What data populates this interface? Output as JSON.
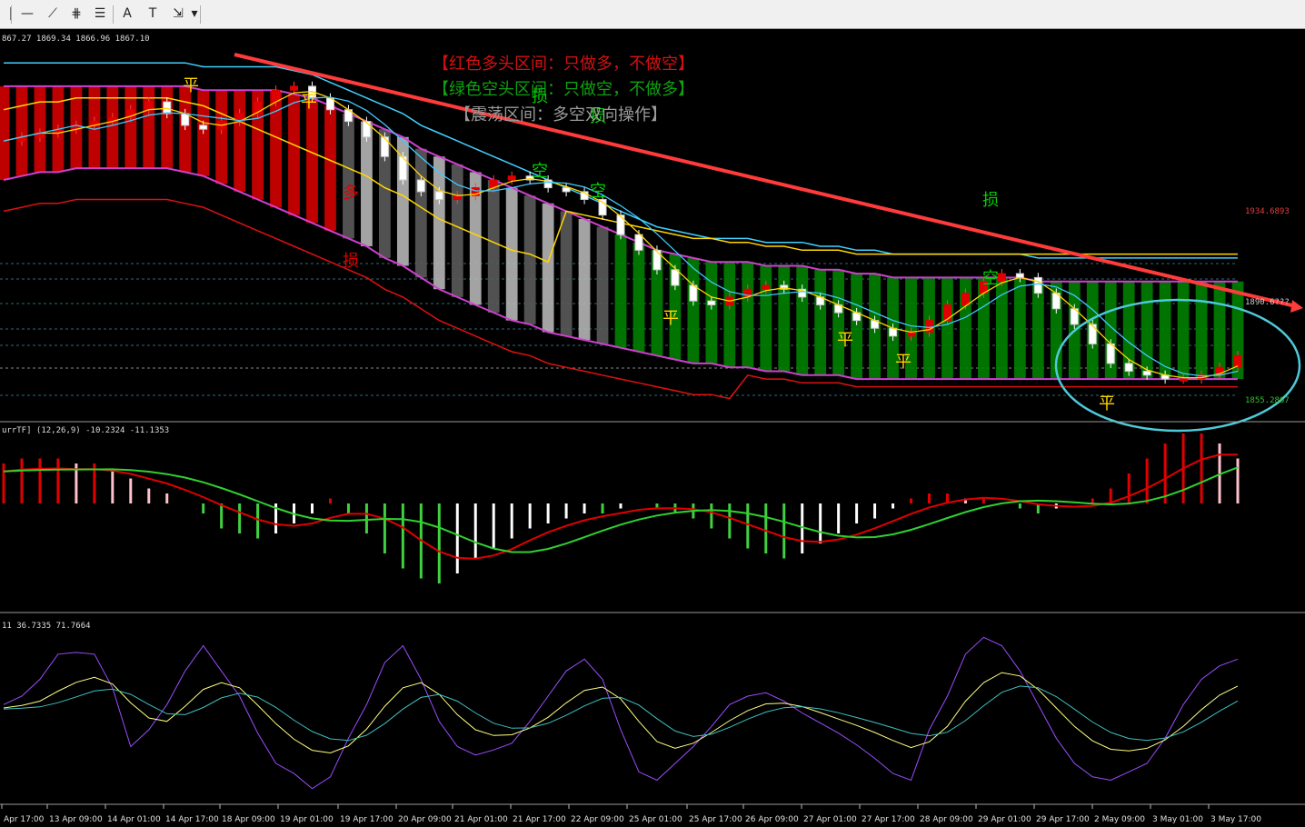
{
  "toolbar": {
    "buttons": [
      {
        "name": "cursor-button",
        "icon": "crosshair-icon",
        "glyph": "|"
      },
      {
        "name": "hline-button",
        "icon": "horizontal-line-icon",
        "glyph": "—"
      },
      {
        "name": "trendline-button",
        "icon": "trend-line-icon",
        "glyph": "⟋"
      },
      {
        "name": "channel-button",
        "icon": "channel-icon",
        "glyph": "⋕"
      },
      {
        "name": "fibo-button",
        "icon": "fibonacci-icon",
        "glyph": "☰"
      },
      {
        "name": "text-button",
        "icon": "text-icon",
        "glyph": "A"
      },
      {
        "name": "label-button",
        "icon": "text-label-icon",
        "glyph": "T"
      },
      {
        "name": "shapes-button",
        "icon": "shapes-icon",
        "glyph": "⇲"
      },
      {
        "name": "dropdown-button",
        "icon": "chevron-down-icon",
        "glyph": "▾"
      }
    ]
  },
  "main": {
    "ohlc_text": "867.27 1869.34 1866.96 1867.10",
    "price_top": "1934.6893",
    "price_mid": "1890.6???",
    "price_bottom": "1855.2867",
    "legend_red": "【红色多头区间：只做多，不做空】",
    "legend_green": "【绿色空头区间：只做空，不做多】",
    "legend_gray": "【震荡区间：多空双向操作】",
    "annotations": [
      {
        "text": "平",
        "color": "#ffd700"
      },
      {
        "text": "平",
        "color": "#ffd700"
      },
      {
        "text": "多",
        "color": "#e00000"
      },
      {
        "text": "损",
        "color": "#e00000"
      },
      {
        "text": "损",
        "color": "#00d000"
      },
      {
        "text": "损",
        "color": "#00d000"
      },
      {
        "text": "空",
        "color": "#00d000"
      },
      {
        "text": "空",
        "color": "#00d000"
      },
      {
        "text": "平",
        "color": "#ffd700"
      },
      {
        "text": "平",
        "color": "#ffd700"
      },
      {
        "text": "平",
        "color": "#ffd700"
      },
      {
        "text": "损",
        "color": "#00d000"
      },
      {
        "text": "空",
        "color": "#00d000"
      },
      {
        "text": "平",
        "color": "#ffd700"
      }
    ]
  },
  "macd": {
    "header": "urrTF] (12,26,9) -10.2324 -11.1353"
  },
  "stoch": {
    "header": "11 36.7335 71.7664"
  },
  "x_axis_labels": [
    "Apr 17:00",
    "13 Apr 09:00",
    "14 Apr 01:00",
    "14 Apr 17:00",
    "18 Apr 09:00",
    "19 Apr 01:00",
    "19 Apr 17:00",
    "20 Apr 09:00",
    "21 Apr 01:00",
    "21 Apr 17:00",
    "22 Apr 09:00",
    "25 Apr 01:00",
    "25 Apr 17:00",
    "26 Apr 09:00",
    "27 Apr 01:00",
    "27 Apr 17:00",
    "28 Apr 09:00",
    "29 Apr 01:00",
    "29 Apr 17:00",
    "2 May 09:00",
    "3 May 01:00",
    "3 May 17:00"
  ],
  "colors": {
    "bull": "#e00000",
    "bear": "#008000",
    "neutral": "#7a7a7a",
    "trendline": "#ff3b3b",
    "circle": "#4ec9d8"
  },
  "chart_data": [
    {
      "type": "candlestick",
      "title": "",
      "ylim": [
        1850,
        1945
      ],
      "close": [
        1921,
        1922,
        1923,
        1924,
        1925,
        1926,
        1927,
        1929,
        1931,
        1928,
        1925,
        1924,
        1926,
        1928,
        1931,
        1934,
        1935,
        1932,
        1929,
        1926,
        1922,
        1917,
        1911,
        1908,
        1906,
        1907,
        1909,
        1911,
        1912,
        1911,
        1909,
        1908,
        1906,
        1902,
        1897,
        1893,
        1888,
        1884,
        1880,
        1879,
        1881,
        1883,
        1884,
        1883,
        1881,
        1879,
        1877,
        1875,
        1873,
        1871,
        1872,
        1875,
        1879,
        1882,
        1885,
        1887,
        1886,
        1882,
        1878,
        1874,
        1869,
        1864,
        1862,
        1861,
        1860,
        1860,
        1861,
        1863,
        1866
      ],
      "band_upper": [
        1935,
        1935,
        1935,
        1935,
        1935,
        1935,
        1935,
        1935,
        1935,
        1935,
        1935,
        1934,
        1934,
        1934,
        1934,
        1934,
        1933,
        1932,
        1930,
        1928,
        1926,
        1924,
        1922,
        1919,
        1917,
        1915,
        1913,
        1911,
        1909,
        1907,
        1905,
        1903,
        1901,
        1899,
        1897,
        1895,
        1893,
        1892,
        1891,
        1890,
        1890,
        1890,
        1889,
        1889,
        1889,
        1888,
        1888,
        1887,
        1887,
        1886,
        1886,
        1886,
        1886,
        1886,
        1886,
        1886,
        1886,
        1885,
        1885,
        1885,
        1885,
        1885,
        1885,
        1885,
        1885,
        1885,
        1885,
        1885,
        1885
      ],
      "band_lower": [
        1911,
        1912,
        1913,
        1913,
        1914,
        1914,
        1914,
        1914,
        1914,
        1914,
        1913,
        1912,
        1910,
        1908,
        1906,
        1904,
        1902,
        1900,
        1898,
        1896,
        1894,
        1891,
        1889,
        1886,
        1883,
        1881,
        1879,
        1877,
        1875,
        1874,
        1872,
        1871,
        1870,
        1869,
        1868,
        1867,
        1866,
        1865,
        1864,
        1864,
        1863,
        1863,
        1862,
        1862,
        1861,
        1861,
        1861,
        1860,
        1860,
        1860,
        1860,
        1860,
        1860,
        1860,
        1860,
        1860,
        1860,
        1860,
        1860,
        1860,
        1860,
        1860,
        1860,
        1860,
        1860,
        1860,
        1860,
        1860,
        1860
      ],
      "regime": [
        "bull",
        "bull",
        "bull",
        "bull",
        "bull",
        "bull",
        "bull",
        "bull",
        "bull",
        "bull",
        "bull",
        "bull",
        "bull",
        "bull",
        "bull",
        "bull",
        "bull",
        "bull",
        "bull",
        "neutral",
        "neutral",
        "neutral",
        "neutral",
        "neutral",
        "neutral",
        "neutral",
        "neutral",
        "neutral",
        "neutral",
        "neutral",
        "neutral",
        "neutral",
        "neutral",
        "neutral",
        "bear",
        "bear",
        "bear",
        "bear",
        "bear",
        "bear",
        "bear",
        "bear",
        "bear",
        "bear",
        "bear",
        "bear",
        "bear",
        "bear",
        "bear",
        "bear",
        "bear",
        "bear",
        "bear",
        "bear",
        "bear",
        "bear",
        "bear",
        "bear",
        "bear",
        "bear",
        "bear",
        "bear",
        "bear",
        "bear",
        "bear",
        "bear",
        "bear",
        "bear",
        "bear"
      ]
    },
    {
      "type": "bar",
      "title": "",
      "values": [
        8,
        9,
        9,
        9,
        8,
        8,
        7,
        5,
        3,
        2,
        0,
        -2,
        -5,
        -6,
        -7,
        -6,
        -4,
        -2,
        1,
        -2,
        -6,
        -10,
        -13,
        -15,
        -16,
        -14,
        -11,
        -9,
        -7,
        -5,
        -4,
        -3,
        -2,
        -2,
        -1,
        0,
        -1,
        -2,
        -3,
        -5,
        -7,
        -9,
        -10,
        -11,
        -10,
        -8,
        -6,
        -4,
        -3,
        -1,
        1,
        2,
        2,
        1,
        1,
        0,
        -1,
        -2,
        -1,
        0,
        1,
        3,
        6,
        9,
        12,
        14,
        14,
        12,
        9
      ],
      "ylim": [
        -16,
        16
      ]
    },
    {
      "type": "line",
      "title": "",
      "ylim": [
        0,
        100
      ],
      "series": [
        {
          "values": [
            55,
            60,
            70,
            85,
            86,
            85,
            65,
            30,
            40,
            55,
            75,
            90,
            75,
            60,
            38,
            20,
            14,
            5,
            12,
            35,
            55,
            80,
            90,
            70,
            45,
            30,
            25,
            28,
            32,
            45,
            60,
            75,
            82,
            70,
            40,
            15,
            10,
            20,
            30,
            42,
            55,
            60,
            62,
            57,
            50,
            44,
            38,
            31,
            23,
            14,
            10,
            40,
            60,
            85,
            95,
            90,
            75,
            55,
            35,
            20,
            12,
            10,
            15,
            20,
            35,
            55,
            70,
            78,
            82
          ]
        }
      ]
    }
  ]
}
